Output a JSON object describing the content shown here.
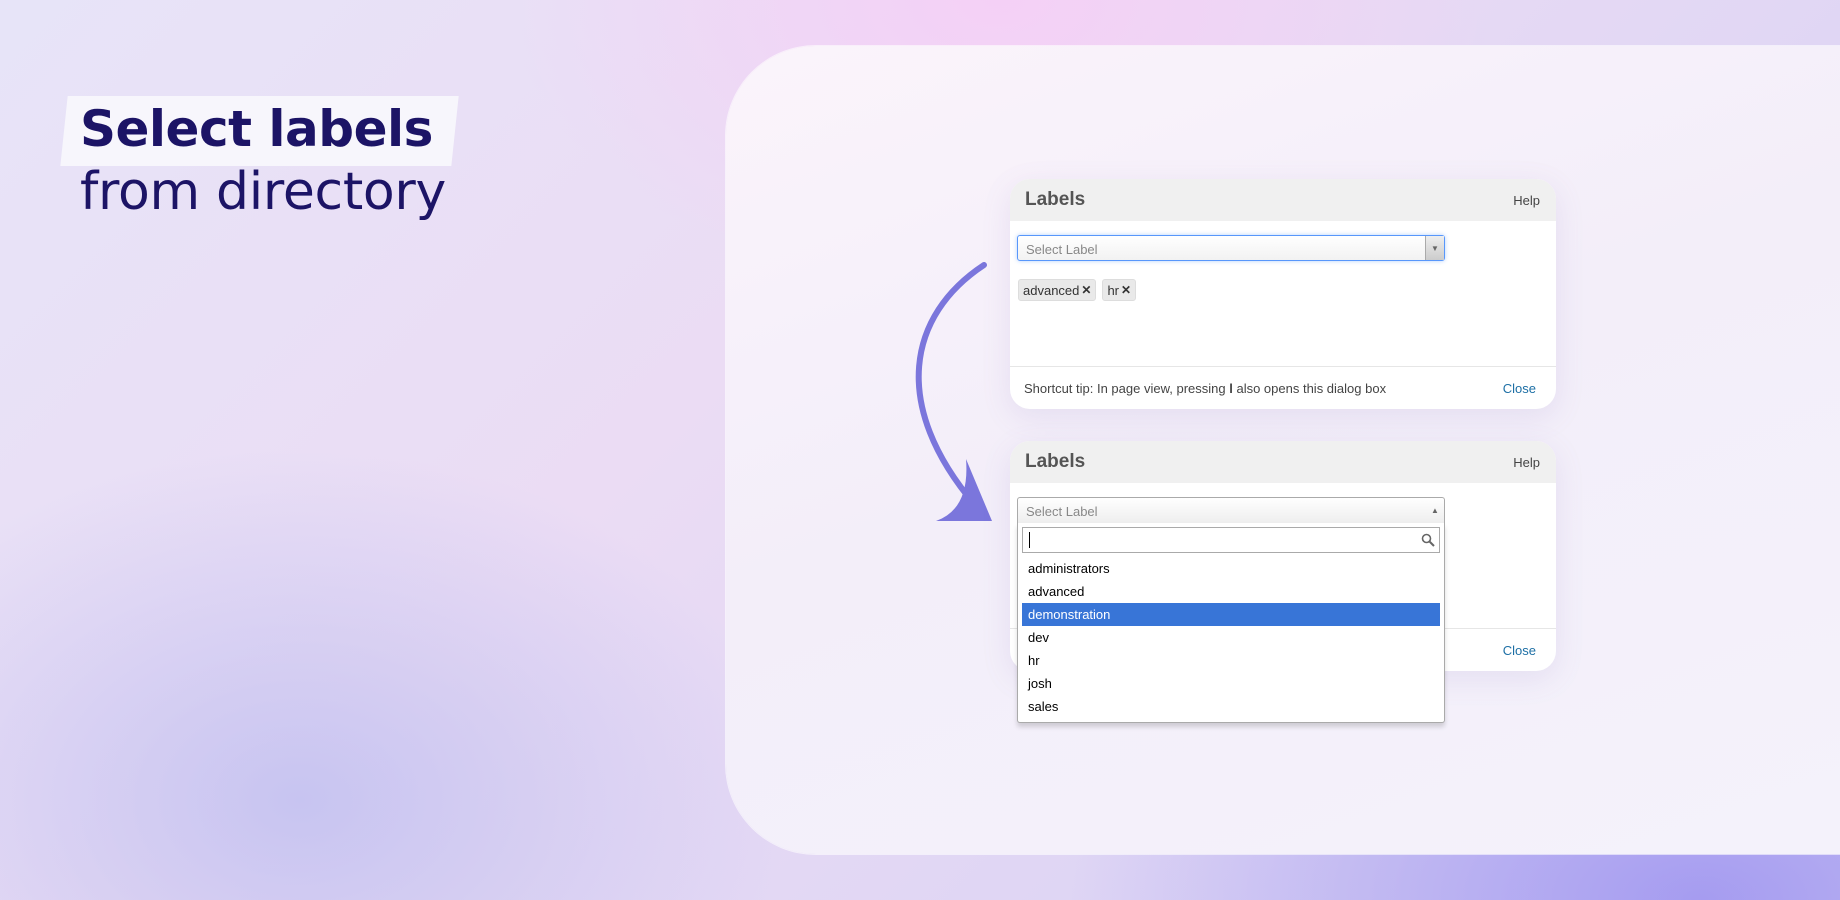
{
  "headline": {
    "line1": "Select labels",
    "line2": "from directory"
  },
  "dialog_top": {
    "title": "Labels",
    "help": "Help",
    "select_placeholder": "Select Label",
    "tags": [
      {
        "label": "advanced"
      },
      {
        "label": "hr"
      }
    ],
    "tip_prefix": "Shortcut tip: In page view, pressing ",
    "tip_key": "l",
    "tip_suffix": " also opens this dialog box",
    "close": "Close"
  },
  "dialog_bottom": {
    "title": "Labels",
    "help": "Help",
    "select_placeholder": "Select Label",
    "search_value": "",
    "options": [
      {
        "label": "administrators"
      },
      {
        "label": "advanced"
      },
      {
        "label": "demonstration",
        "highlighted": true
      },
      {
        "label": "dev"
      },
      {
        "label": "hr"
      },
      {
        "label": "josh"
      },
      {
        "label": "sales"
      }
    ],
    "close": "Close"
  },
  "colors": {
    "headline": "#1c1466",
    "arrow": "#7b76dc",
    "highlight": "#3875d7",
    "link": "#1d6fa5"
  }
}
